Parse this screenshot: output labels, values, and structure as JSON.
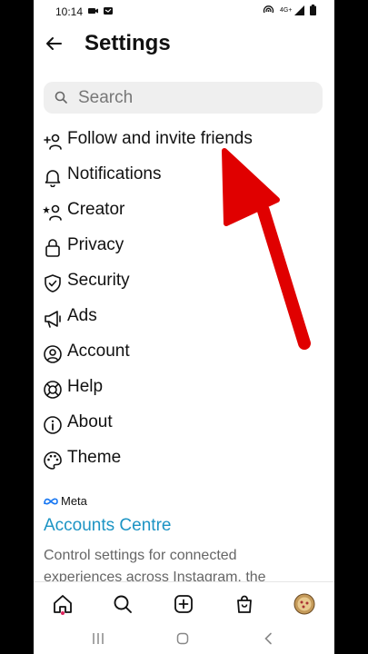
{
  "status": {
    "time": "10:14",
    "network_label": "4G+"
  },
  "header": {
    "title": "Settings"
  },
  "search": {
    "placeholder": "Search"
  },
  "menu": [
    {
      "label": "Follow and invite friends",
      "icon": "add-person-icon"
    },
    {
      "label": "Notifications",
      "icon": "bell-icon"
    },
    {
      "label": "Creator",
      "icon": "creator-icon"
    },
    {
      "label": "Privacy",
      "icon": "lock-icon"
    },
    {
      "label": "Security",
      "icon": "shield-icon"
    },
    {
      "label": "Ads",
      "icon": "megaphone-icon"
    },
    {
      "label": "Account",
      "icon": "account-icon"
    },
    {
      "label": "Help",
      "icon": "lifebuoy-icon"
    },
    {
      "label": "About",
      "icon": "info-icon"
    },
    {
      "label": "Theme",
      "icon": "palette-icon"
    }
  ],
  "meta": {
    "brand": "Meta",
    "accounts_centre": "Accounts Centre",
    "description": "Control settings for connected experiences across Instagram, the"
  },
  "colors": {
    "accent": "#1c94c4",
    "arrow": "#e00000"
  }
}
